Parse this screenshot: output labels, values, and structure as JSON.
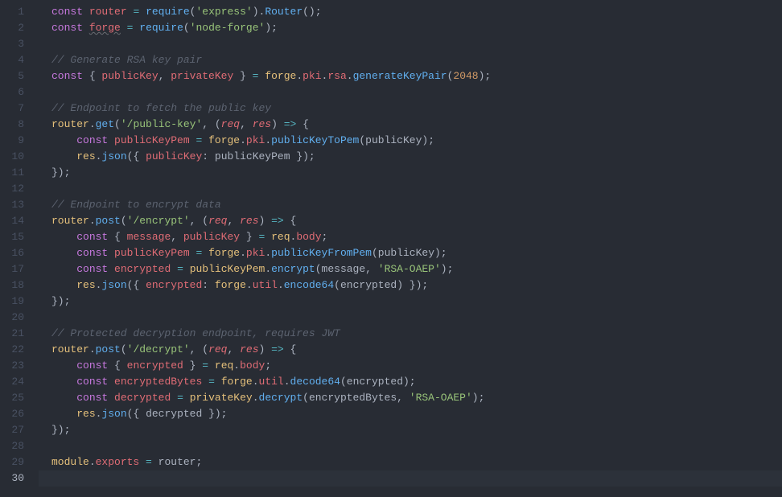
{
  "editor": {
    "language": "javascript",
    "theme": "one-dark",
    "highlighted_line": 30,
    "line_numbers": [
      "1",
      "2",
      "3",
      "4",
      "5",
      "6",
      "7",
      "8",
      "9",
      "10",
      "11",
      "12",
      "13",
      "14",
      "15",
      "16",
      "17",
      "18",
      "19",
      "20",
      "21",
      "22",
      "23",
      "24",
      "25",
      "26",
      "27",
      "28",
      "29",
      "30"
    ],
    "lines": [
      {
        "n": 1,
        "indent": 0,
        "tokens": [
          [
            "decl",
            "const "
          ],
          [
            "var",
            "router"
          ],
          [
            "plain",
            " "
          ],
          [
            "op",
            "="
          ],
          [
            "plain",
            " "
          ],
          [
            "fn",
            "require"
          ],
          [
            "punct",
            "("
          ],
          [
            "str",
            "'express'"
          ],
          [
            "punct",
            ")."
          ],
          [
            "fn",
            "Router"
          ],
          [
            "punct",
            "();"
          ]
        ]
      },
      {
        "n": 2,
        "indent": 0,
        "tokens": [
          [
            "decl",
            "const "
          ],
          [
            "var",
            "forge"
          ],
          [
            "plain",
            " "
          ],
          [
            "op",
            "="
          ],
          [
            "plain",
            " "
          ],
          [
            "fn",
            "require"
          ],
          [
            "punct",
            "("
          ],
          [
            "str",
            "'node-forge'"
          ],
          [
            "punct",
            ");"
          ]
        ]
      },
      {
        "n": 3,
        "indent": 0,
        "tokens": []
      },
      {
        "n": 4,
        "indent": 0,
        "tokens": [
          [
            "cmt",
            "// Generate RSA key pair"
          ]
        ]
      },
      {
        "n": 5,
        "indent": 0,
        "tokens": [
          [
            "decl",
            "const "
          ],
          [
            "punct",
            "{ "
          ],
          [
            "var",
            "publicKey"
          ],
          [
            "punct",
            ", "
          ],
          [
            "var",
            "privateKey"
          ],
          [
            "punct",
            " } "
          ],
          [
            "op",
            "="
          ],
          [
            "plain",
            " "
          ],
          [
            "obj",
            "forge"
          ],
          [
            "punct",
            "."
          ],
          [
            "prop",
            "pki"
          ],
          [
            "punct",
            "."
          ],
          [
            "prop",
            "rsa"
          ],
          [
            "punct",
            "."
          ],
          [
            "fn",
            "generateKeyPair"
          ],
          [
            "punct",
            "("
          ],
          [
            "num",
            "2048"
          ],
          [
            "punct",
            ");"
          ]
        ]
      },
      {
        "n": 6,
        "indent": 0,
        "tokens": []
      },
      {
        "n": 7,
        "indent": 0,
        "tokens": [
          [
            "cmt",
            "// Endpoint to fetch the public key"
          ]
        ]
      },
      {
        "n": 8,
        "indent": 0,
        "tokens": [
          [
            "obj",
            "router"
          ],
          [
            "punct",
            "."
          ],
          [
            "fn",
            "get"
          ],
          [
            "punct",
            "("
          ],
          [
            "str",
            "'/public-key'"
          ],
          [
            "punct",
            ", ("
          ],
          [
            "param",
            "req"
          ],
          [
            "punct",
            ", "
          ],
          [
            "param",
            "res"
          ],
          [
            "punct",
            ") "
          ],
          [
            "op",
            "=>"
          ],
          [
            "punct",
            " {"
          ]
        ]
      },
      {
        "n": 9,
        "indent": 1,
        "tokens": [
          [
            "decl",
            "const "
          ],
          [
            "var",
            "publicKeyPem"
          ],
          [
            "plain",
            " "
          ],
          [
            "op",
            "="
          ],
          [
            "plain",
            " "
          ],
          [
            "obj",
            "forge"
          ],
          [
            "punct",
            "."
          ],
          [
            "prop",
            "pki"
          ],
          [
            "punct",
            "."
          ],
          [
            "fn",
            "publicKeyToPem"
          ],
          [
            "punct",
            "("
          ],
          [
            "plain",
            "publicKey"
          ],
          [
            "punct",
            ");"
          ]
        ]
      },
      {
        "n": 10,
        "indent": 1,
        "tokens": [
          [
            "obj",
            "res"
          ],
          [
            "punct",
            "."
          ],
          [
            "fn",
            "json"
          ],
          [
            "punct",
            "({ "
          ],
          [
            "prop",
            "publicKey"
          ],
          [
            "punct",
            ": "
          ],
          [
            "plain",
            "publicKeyPem"
          ],
          [
            "punct",
            " });"
          ]
        ]
      },
      {
        "n": 11,
        "indent": 0,
        "tokens": [
          [
            "punct",
            "});"
          ]
        ]
      },
      {
        "n": 12,
        "indent": 0,
        "tokens": []
      },
      {
        "n": 13,
        "indent": 0,
        "tokens": [
          [
            "cmt",
            "// Endpoint to encrypt data"
          ]
        ]
      },
      {
        "n": 14,
        "indent": 0,
        "tokens": [
          [
            "obj",
            "router"
          ],
          [
            "punct",
            "."
          ],
          [
            "fn",
            "post"
          ],
          [
            "punct",
            "("
          ],
          [
            "str",
            "'/encrypt'"
          ],
          [
            "punct",
            ", ("
          ],
          [
            "param",
            "req"
          ],
          [
            "punct",
            ", "
          ],
          [
            "param",
            "res"
          ],
          [
            "punct",
            ") "
          ],
          [
            "op",
            "=>"
          ],
          [
            "punct",
            " {"
          ]
        ]
      },
      {
        "n": 15,
        "indent": 1,
        "tokens": [
          [
            "decl",
            "const "
          ],
          [
            "punct",
            "{ "
          ],
          [
            "var",
            "message"
          ],
          [
            "punct",
            ", "
          ],
          [
            "var",
            "publicKey"
          ],
          [
            "punct",
            " } "
          ],
          [
            "op",
            "="
          ],
          [
            "plain",
            " "
          ],
          [
            "obj",
            "req"
          ],
          [
            "punct",
            "."
          ],
          [
            "prop",
            "body"
          ],
          [
            "punct",
            ";"
          ]
        ]
      },
      {
        "n": 16,
        "indent": 1,
        "tokens": [
          [
            "decl",
            "const "
          ],
          [
            "var",
            "publicKeyPem"
          ],
          [
            "plain",
            " "
          ],
          [
            "op",
            "="
          ],
          [
            "plain",
            " "
          ],
          [
            "obj",
            "forge"
          ],
          [
            "punct",
            "."
          ],
          [
            "prop",
            "pki"
          ],
          [
            "punct",
            "."
          ],
          [
            "fn",
            "publicKeyFromPem"
          ],
          [
            "punct",
            "("
          ],
          [
            "plain",
            "publicKey"
          ],
          [
            "punct",
            ");"
          ]
        ]
      },
      {
        "n": 17,
        "indent": 1,
        "tokens": [
          [
            "decl",
            "const "
          ],
          [
            "var",
            "encrypted"
          ],
          [
            "plain",
            " "
          ],
          [
            "op",
            "="
          ],
          [
            "plain",
            " "
          ],
          [
            "obj",
            "publicKeyPem"
          ],
          [
            "punct",
            "."
          ],
          [
            "fn",
            "encrypt"
          ],
          [
            "punct",
            "("
          ],
          [
            "plain",
            "message"
          ],
          [
            "punct",
            ", "
          ],
          [
            "str",
            "'RSA-OAEP'"
          ],
          [
            "punct",
            ");"
          ]
        ]
      },
      {
        "n": 18,
        "indent": 1,
        "tokens": [
          [
            "obj",
            "res"
          ],
          [
            "punct",
            "."
          ],
          [
            "fn",
            "json"
          ],
          [
            "punct",
            "({ "
          ],
          [
            "prop",
            "encrypted"
          ],
          [
            "punct",
            ": "
          ],
          [
            "obj",
            "forge"
          ],
          [
            "punct",
            "."
          ],
          [
            "prop",
            "util"
          ],
          [
            "punct",
            "."
          ],
          [
            "fn",
            "encode64"
          ],
          [
            "punct",
            "("
          ],
          [
            "plain",
            "encrypted"
          ],
          [
            "punct",
            ") });"
          ]
        ]
      },
      {
        "n": 19,
        "indent": 0,
        "tokens": [
          [
            "punct",
            "});"
          ]
        ]
      },
      {
        "n": 20,
        "indent": 0,
        "tokens": []
      },
      {
        "n": 21,
        "indent": 0,
        "tokens": [
          [
            "cmt",
            "// Protected decryption endpoint, requires JWT"
          ]
        ]
      },
      {
        "n": 22,
        "indent": 0,
        "tokens": [
          [
            "obj",
            "router"
          ],
          [
            "punct",
            "."
          ],
          [
            "fn",
            "post"
          ],
          [
            "punct",
            "("
          ],
          [
            "str",
            "'/decrypt'"
          ],
          [
            "punct",
            ", ("
          ],
          [
            "param",
            "req"
          ],
          [
            "punct",
            ", "
          ],
          [
            "param",
            "res"
          ],
          [
            "punct",
            ") "
          ],
          [
            "op",
            "=>"
          ],
          [
            "punct",
            " {"
          ]
        ]
      },
      {
        "n": 23,
        "indent": 1,
        "tokens": [
          [
            "decl",
            "const "
          ],
          [
            "punct",
            "{ "
          ],
          [
            "var",
            "encrypted"
          ],
          [
            "punct",
            " } "
          ],
          [
            "op",
            "="
          ],
          [
            "plain",
            " "
          ],
          [
            "obj",
            "req"
          ],
          [
            "punct",
            "."
          ],
          [
            "prop",
            "body"
          ],
          [
            "punct",
            ";"
          ]
        ]
      },
      {
        "n": 24,
        "indent": 1,
        "tokens": [
          [
            "decl",
            "const "
          ],
          [
            "var",
            "encryptedBytes"
          ],
          [
            "plain",
            " "
          ],
          [
            "op",
            "="
          ],
          [
            "plain",
            " "
          ],
          [
            "obj",
            "forge"
          ],
          [
            "punct",
            "."
          ],
          [
            "prop",
            "util"
          ],
          [
            "punct",
            "."
          ],
          [
            "fn",
            "decode64"
          ],
          [
            "punct",
            "("
          ],
          [
            "plain",
            "encrypted"
          ],
          [
            "punct",
            ");"
          ]
        ]
      },
      {
        "n": 25,
        "indent": 1,
        "tokens": [
          [
            "decl",
            "const "
          ],
          [
            "var",
            "decrypted"
          ],
          [
            "plain",
            " "
          ],
          [
            "op",
            "="
          ],
          [
            "plain",
            " "
          ],
          [
            "obj",
            "privateKey"
          ],
          [
            "punct",
            "."
          ],
          [
            "fn",
            "decrypt"
          ],
          [
            "punct",
            "("
          ],
          [
            "plain",
            "encryptedBytes"
          ],
          [
            "punct",
            ", "
          ],
          [
            "str",
            "'RSA-OAEP'"
          ],
          [
            "punct",
            ");"
          ]
        ]
      },
      {
        "n": 26,
        "indent": 1,
        "tokens": [
          [
            "obj",
            "res"
          ],
          [
            "punct",
            "."
          ],
          [
            "fn",
            "json"
          ],
          [
            "punct",
            "({ "
          ],
          [
            "plain",
            "decrypted"
          ],
          [
            "punct",
            " });"
          ]
        ]
      },
      {
        "n": 27,
        "indent": 0,
        "tokens": [
          [
            "punct",
            "});"
          ]
        ]
      },
      {
        "n": 28,
        "indent": 0,
        "tokens": []
      },
      {
        "n": 29,
        "indent": 0,
        "tokens": [
          [
            "obj",
            "module"
          ],
          [
            "punct",
            "."
          ],
          [
            "prop",
            "exports"
          ],
          [
            "plain",
            " "
          ],
          [
            "op",
            "="
          ],
          [
            "plain",
            " "
          ],
          [
            "plain",
            "router"
          ],
          [
            "punct",
            ";"
          ]
        ]
      },
      {
        "n": 30,
        "indent": 0,
        "tokens": []
      }
    ],
    "squiggle_lines": [
      2
    ]
  }
}
